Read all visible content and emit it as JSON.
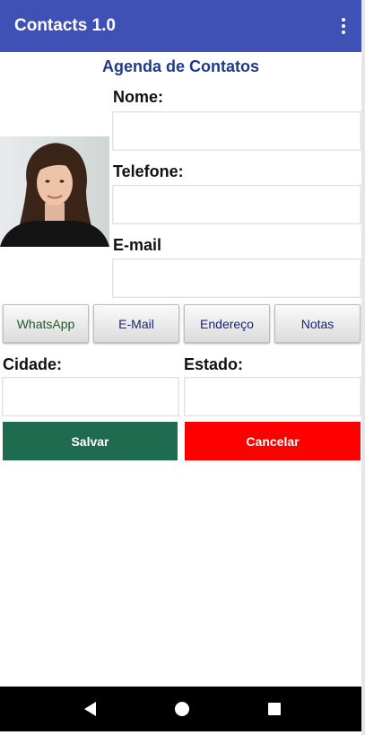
{
  "appbar": {
    "title": "Contacts 1.0",
    "menu_icon": "more-vert-icon"
  },
  "heading": "Agenda de Contatos",
  "form": {
    "nome_label": "Nome:",
    "telefone_label": "Telefone:",
    "email_label": "E-mail",
    "cidade_label": "Cidade:",
    "estado_label": "Estado:"
  },
  "tabs": {
    "whatsapp": "WhatsApp",
    "email": "E-Mail",
    "endereco": "Endereço",
    "notas": "Notas"
  },
  "actions": {
    "salvar": "Salvar",
    "cancelar": "Cancelar"
  },
  "colors": {
    "appbar": "#3f51b5",
    "heading": "#1e3a8a",
    "salvar": "#1e6b50",
    "cancelar": "#ff0000",
    "whatsapp_text": "#1b5e20",
    "tab_text": "#1a237e"
  }
}
